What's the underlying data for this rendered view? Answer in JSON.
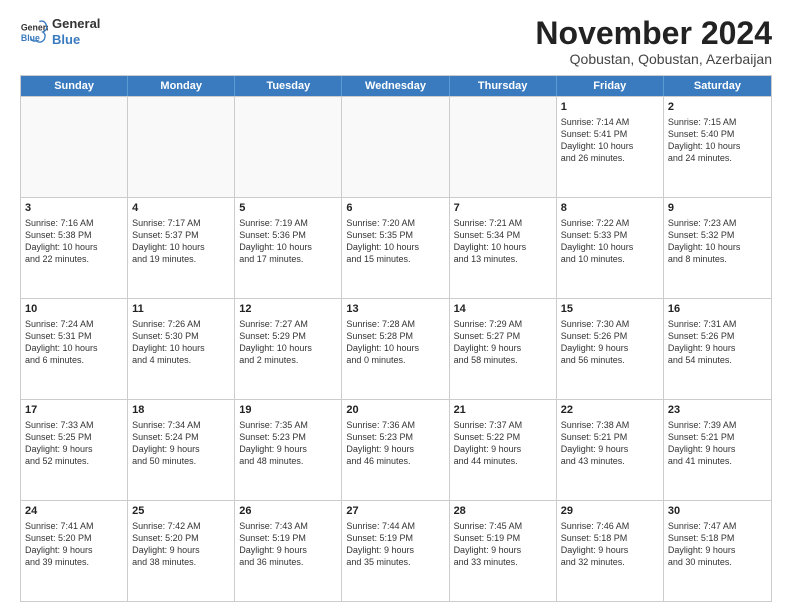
{
  "logo": {
    "line1": "General",
    "line2": "Blue"
  },
  "title": "November 2024",
  "subtitle": "Qobustan, Qobustan, Azerbaijan",
  "header_days": [
    "Sunday",
    "Monday",
    "Tuesday",
    "Wednesday",
    "Thursday",
    "Friday",
    "Saturday"
  ],
  "weeks": [
    [
      {
        "day": "",
        "info": "",
        "empty": true
      },
      {
        "day": "",
        "info": "",
        "empty": true
      },
      {
        "day": "",
        "info": "",
        "empty": true
      },
      {
        "day": "",
        "info": "",
        "empty": true
      },
      {
        "day": "",
        "info": "",
        "empty": true
      },
      {
        "day": "1",
        "info": "Sunrise: 7:14 AM\nSunset: 5:41 PM\nDaylight: 10 hours\nand 26 minutes."
      },
      {
        "day": "2",
        "info": "Sunrise: 7:15 AM\nSunset: 5:40 PM\nDaylight: 10 hours\nand 24 minutes."
      }
    ],
    [
      {
        "day": "3",
        "info": "Sunrise: 7:16 AM\nSunset: 5:38 PM\nDaylight: 10 hours\nand 22 minutes."
      },
      {
        "day": "4",
        "info": "Sunrise: 7:17 AM\nSunset: 5:37 PM\nDaylight: 10 hours\nand 19 minutes."
      },
      {
        "day": "5",
        "info": "Sunrise: 7:19 AM\nSunset: 5:36 PM\nDaylight: 10 hours\nand 17 minutes."
      },
      {
        "day": "6",
        "info": "Sunrise: 7:20 AM\nSunset: 5:35 PM\nDaylight: 10 hours\nand 15 minutes."
      },
      {
        "day": "7",
        "info": "Sunrise: 7:21 AM\nSunset: 5:34 PM\nDaylight: 10 hours\nand 13 minutes."
      },
      {
        "day": "8",
        "info": "Sunrise: 7:22 AM\nSunset: 5:33 PM\nDaylight: 10 hours\nand 10 minutes."
      },
      {
        "day": "9",
        "info": "Sunrise: 7:23 AM\nSunset: 5:32 PM\nDaylight: 10 hours\nand 8 minutes."
      }
    ],
    [
      {
        "day": "10",
        "info": "Sunrise: 7:24 AM\nSunset: 5:31 PM\nDaylight: 10 hours\nand 6 minutes."
      },
      {
        "day": "11",
        "info": "Sunrise: 7:26 AM\nSunset: 5:30 PM\nDaylight: 10 hours\nand 4 minutes."
      },
      {
        "day": "12",
        "info": "Sunrise: 7:27 AM\nSunset: 5:29 PM\nDaylight: 10 hours\nand 2 minutes."
      },
      {
        "day": "13",
        "info": "Sunrise: 7:28 AM\nSunset: 5:28 PM\nDaylight: 10 hours\nand 0 minutes."
      },
      {
        "day": "14",
        "info": "Sunrise: 7:29 AM\nSunset: 5:27 PM\nDaylight: 9 hours\nand 58 minutes."
      },
      {
        "day": "15",
        "info": "Sunrise: 7:30 AM\nSunset: 5:26 PM\nDaylight: 9 hours\nand 56 minutes."
      },
      {
        "day": "16",
        "info": "Sunrise: 7:31 AM\nSunset: 5:26 PM\nDaylight: 9 hours\nand 54 minutes."
      }
    ],
    [
      {
        "day": "17",
        "info": "Sunrise: 7:33 AM\nSunset: 5:25 PM\nDaylight: 9 hours\nand 52 minutes."
      },
      {
        "day": "18",
        "info": "Sunrise: 7:34 AM\nSunset: 5:24 PM\nDaylight: 9 hours\nand 50 minutes."
      },
      {
        "day": "19",
        "info": "Sunrise: 7:35 AM\nSunset: 5:23 PM\nDaylight: 9 hours\nand 48 minutes."
      },
      {
        "day": "20",
        "info": "Sunrise: 7:36 AM\nSunset: 5:23 PM\nDaylight: 9 hours\nand 46 minutes."
      },
      {
        "day": "21",
        "info": "Sunrise: 7:37 AM\nSunset: 5:22 PM\nDaylight: 9 hours\nand 44 minutes."
      },
      {
        "day": "22",
        "info": "Sunrise: 7:38 AM\nSunset: 5:21 PM\nDaylight: 9 hours\nand 43 minutes."
      },
      {
        "day": "23",
        "info": "Sunrise: 7:39 AM\nSunset: 5:21 PM\nDaylight: 9 hours\nand 41 minutes."
      }
    ],
    [
      {
        "day": "24",
        "info": "Sunrise: 7:41 AM\nSunset: 5:20 PM\nDaylight: 9 hours\nand 39 minutes."
      },
      {
        "day": "25",
        "info": "Sunrise: 7:42 AM\nSunset: 5:20 PM\nDaylight: 9 hours\nand 38 minutes."
      },
      {
        "day": "26",
        "info": "Sunrise: 7:43 AM\nSunset: 5:19 PM\nDaylight: 9 hours\nand 36 minutes."
      },
      {
        "day": "27",
        "info": "Sunrise: 7:44 AM\nSunset: 5:19 PM\nDaylight: 9 hours\nand 35 minutes."
      },
      {
        "day": "28",
        "info": "Sunrise: 7:45 AM\nSunset: 5:19 PM\nDaylight: 9 hours\nand 33 minutes."
      },
      {
        "day": "29",
        "info": "Sunrise: 7:46 AM\nSunset: 5:18 PM\nDaylight: 9 hours\nand 32 minutes."
      },
      {
        "day": "30",
        "info": "Sunrise: 7:47 AM\nSunset: 5:18 PM\nDaylight: 9 hours\nand 30 minutes."
      }
    ]
  ]
}
